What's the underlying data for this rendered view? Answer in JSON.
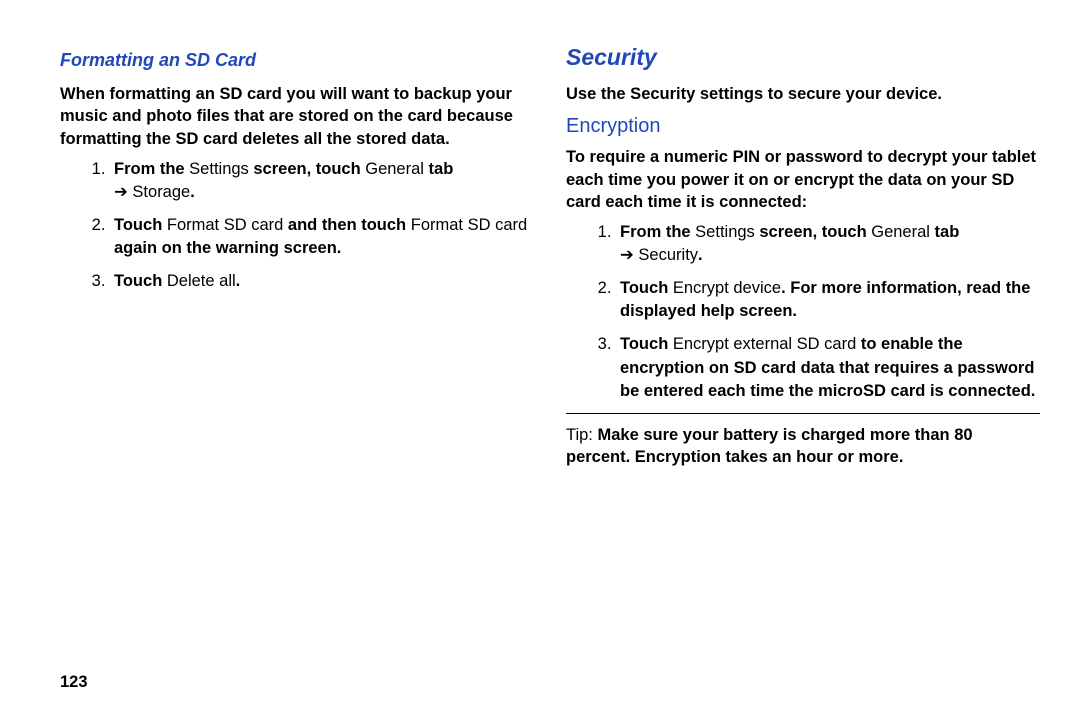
{
  "left": {
    "heading": "Formatting an SD Card",
    "intro": "When formatting an SD card you will want to backup your music and photo files that are stored on the card because formatting the SD card deletes all the stored data.",
    "steps": [
      {
        "segments": [
          {
            "text": "From the ",
            "bold": true
          },
          {
            "text": "Settings",
            "bold": false
          },
          {
            "text": " screen, touch ",
            "bold": true
          },
          {
            "text": "General",
            "bold": false
          },
          {
            "text": " tab",
            "bold": true
          }
        ],
        "nextline": [
          {
            "text": " ➔ ",
            "bold": false
          },
          {
            "text": "Storage",
            "bold": false
          },
          {
            "text": ".",
            "bold": true
          }
        ]
      },
      {
        "segments": [
          {
            "text": "Touch ",
            "bold": true
          },
          {
            "text": "Format SD card",
            "bold": false
          },
          {
            "text": " and then touch ",
            "bold": true
          },
          {
            "text": "Format SD card",
            "bold": false
          },
          {
            "text": " again on the warning screen.",
            "bold": true
          }
        ]
      },
      {
        "segments": [
          {
            "text": "Touch ",
            "bold": true
          },
          {
            "text": "Delete all",
            "bold": false
          },
          {
            "text": ".",
            "bold": true
          }
        ]
      }
    ]
  },
  "right": {
    "section": "Security",
    "intro": "Use the Security settings to secure your device.",
    "sub": "Encryption",
    "body": "To require a numeric PIN or password to decrypt your tablet each time you power it on or encrypt the data on your SD card each time it is connected:",
    "steps": [
      {
        "segments": [
          {
            "text": "From the ",
            "bold": true
          },
          {
            "text": "Settings",
            "bold": false
          },
          {
            "text": " screen, touch ",
            "bold": true
          },
          {
            "text": "General",
            "bold": false
          },
          {
            "text": " tab",
            "bold": true
          }
        ],
        "nextline": [
          {
            "text": " ➔ ",
            "bold": false
          },
          {
            "text": "Security",
            "bold": false
          },
          {
            "text": ".",
            "bold": true
          }
        ]
      },
      {
        "segments": [
          {
            "text": "Touch ",
            "bold": true
          },
          {
            "text": "Encrypt device",
            "bold": false
          },
          {
            "text": ". For more information, read the displayed help screen.",
            "bold": true
          }
        ]
      },
      {
        "segments": [
          {
            "text": "Touch ",
            "bold": true
          },
          {
            "text": "Encrypt external SD card",
            "bold": false
          },
          {
            "text": " to enable the encryption on SD card data that requires a password be entered each time the microSD card is connected.",
            "bold": true
          }
        ]
      }
    ],
    "tip_segments": [
      {
        "text": "Tip:",
        "bold": false
      },
      {
        "text": " Make sure your battery is charged more than 80 percent. Encryption takes an hour or more.",
        "bold": true
      }
    ]
  },
  "page_number": "123"
}
